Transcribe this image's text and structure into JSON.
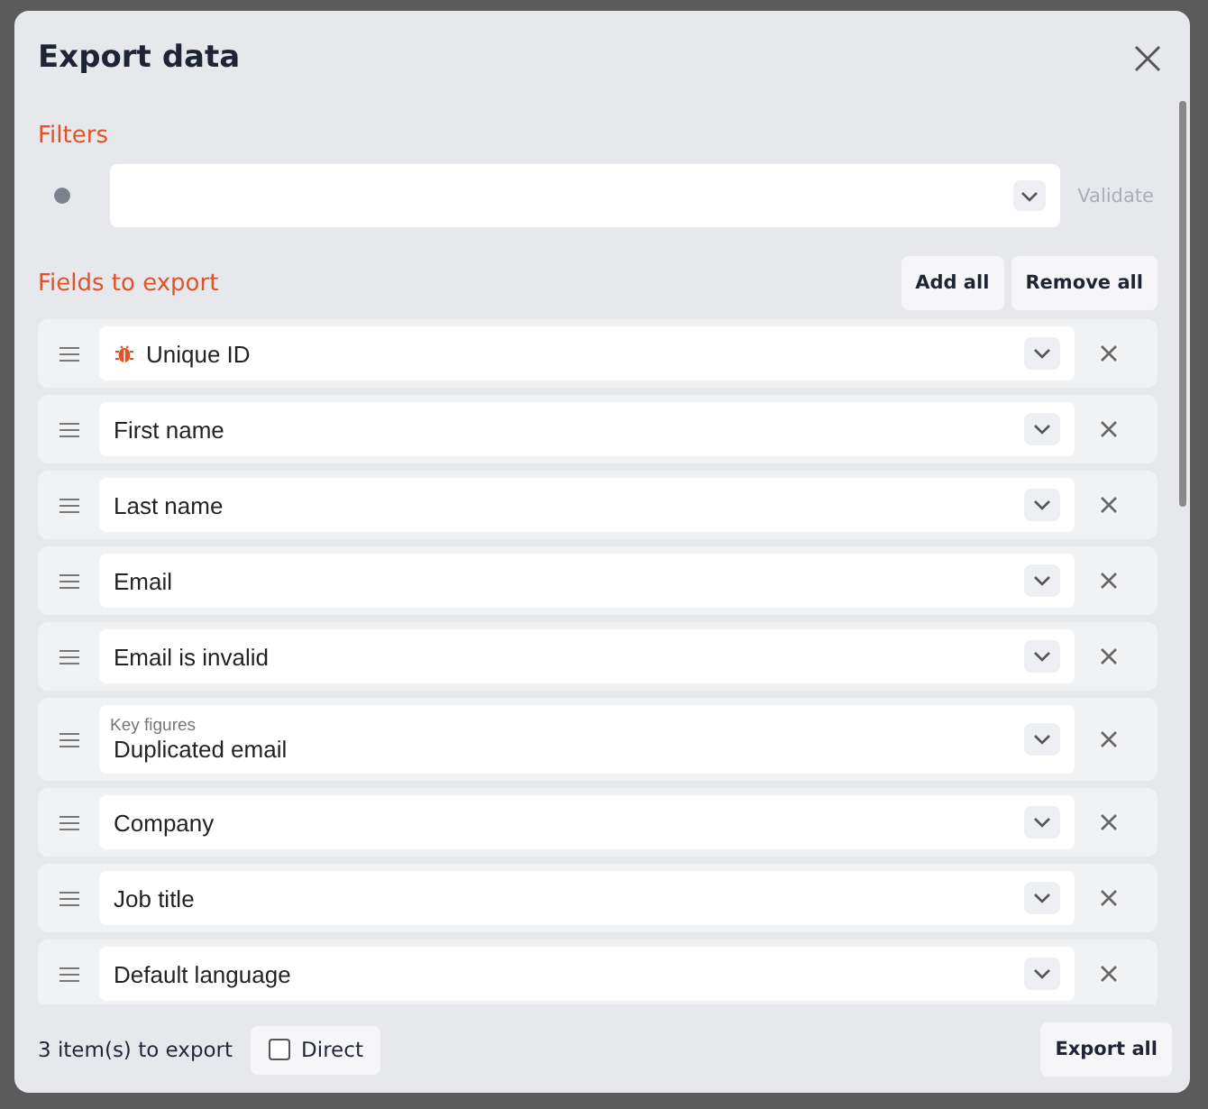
{
  "dialog": {
    "title": "Export data"
  },
  "filters": {
    "heading": "Filters",
    "validate": "Validate"
  },
  "fields_section": {
    "heading": "Fields to export",
    "buttons": [
      "Add all",
      "Remove all"
    ]
  },
  "fields": [
    {
      "kind": "identifier",
      "label": "Unique ID"
    },
    {
      "kind": "plain",
      "label": "First name"
    },
    {
      "kind": "plain",
      "label": "Last name"
    },
    {
      "kind": "plain",
      "label": "Email"
    },
    {
      "kind": "plain",
      "label": "Email is invalid"
    },
    {
      "kind": "grouped",
      "group": "Key figures",
      "label": "Duplicated email"
    },
    {
      "kind": "plain",
      "label": "Company"
    },
    {
      "kind": "plain",
      "label": "Job title"
    },
    {
      "kind": "plain",
      "label": "Default language"
    }
  ],
  "footer": {
    "count": "3 item(s) to export",
    "direct": {
      "label": "Direct",
      "checked": false
    },
    "export": "Export all"
  }
}
